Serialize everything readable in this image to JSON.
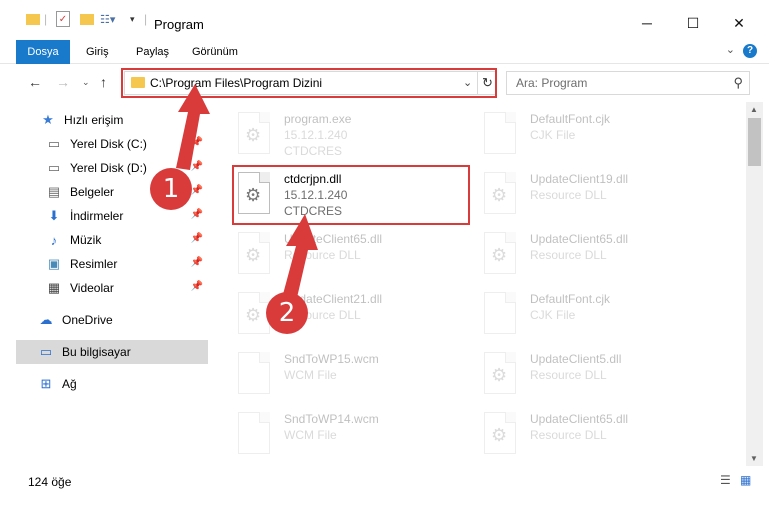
{
  "window": {
    "title": "Program",
    "minimize": "─",
    "maximize": "☐",
    "close": "✕"
  },
  "ribbon": {
    "tabs": [
      "Dosya",
      "Giriş",
      "Paylaş",
      "Görünüm"
    ],
    "help": "?"
  },
  "address": {
    "path": "C:\\Program Files\\Program Dizini",
    "dropdown": "⌄",
    "refresh": "↻"
  },
  "search": {
    "placeholder": "Ara: Program"
  },
  "sidebar": {
    "items": [
      {
        "label": "Hızlı erişim",
        "icon": "star-icon"
      },
      {
        "label": "Yerel Disk (C:)",
        "icon": "drive-icon"
      },
      {
        "label": "Yerel Disk (D:)",
        "icon": "drive-icon"
      },
      {
        "label": "Belgeler",
        "icon": "documents-icon"
      },
      {
        "label": "İndirmeler",
        "icon": "downloads-icon"
      },
      {
        "label": "Müzik",
        "icon": "music-icon"
      },
      {
        "label": "Resimler",
        "icon": "pictures-icon"
      },
      {
        "label": "Videolar",
        "icon": "videos-icon"
      },
      {
        "label": "OneDrive",
        "icon": "cloud-icon"
      },
      {
        "label": "Bu bilgisayar",
        "icon": "computer-icon"
      },
      {
        "label": "Ağ",
        "icon": "network-icon"
      }
    ]
  },
  "files": [
    {
      "name": "program.exe",
      "line2": "15.12.1.240",
      "line3": "CTDCRES"
    },
    {
      "name": "DefaultFont.cjk",
      "line2": "CJK File",
      "line3": ""
    },
    {
      "name": "ctdcrjpn.dll",
      "line2": "15.12.1.240",
      "line3": "CTDCRES"
    },
    {
      "name": "UpdateClient19.dll",
      "line2": "Resource DLL",
      "line3": ""
    },
    {
      "name": "UpdateClient65.dll",
      "line2": "Resource DLL",
      "line3": ""
    },
    {
      "name": "UpdateClient65.dll",
      "line2": "Resource DLL",
      "line3": ""
    },
    {
      "name": "UpdateClient21.dll",
      "line2": "Resource DLL",
      "line3": ""
    },
    {
      "name": "DefaultFont.cjk",
      "line2": "CJK File",
      "line3": ""
    },
    {
      "name": "SndToWP15.wcm",
      "line2": "WCM File",
      "line3": ""
    },
    {
      "name": "UpdateClient5.dll",
      "line2": "Resource DLL",
      "line3": ""
    },
    {
      "name": "SndToWP14.wcm",
      "line2": "WCM File",
      "line3": ""
    },
    {
      "name": "UpdateClient65.dll",
      "line2": "Resource DLL",
      "line3": ""
    }
  ],
  "status": {
    "count": "124 öğe"
  },
  "markers": {
    "one": "1",
    "two": "2"
  },
  "colors": {
    "accent": "#1979ca",
    "highlight": "#d93b3b"
  }
}
